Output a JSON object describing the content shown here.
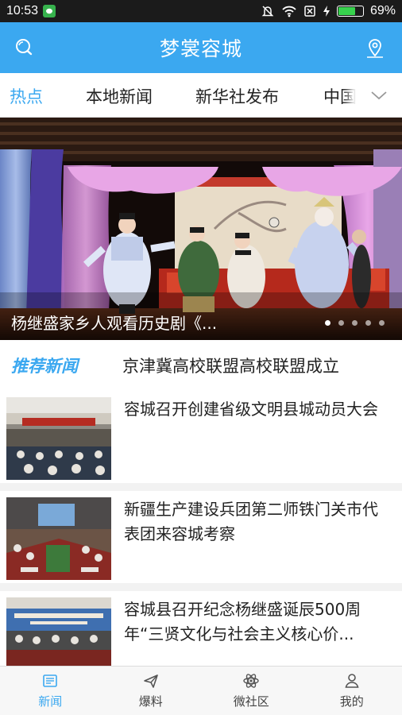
{
  "status": {
    "time": "10:53",
    "battery": "69%",
    "battery_level": 0.69
  },
  "header": {
    "title": "梦裳容城"
  },
  "tabs": [
    {
      "label": "热点",
      "active": true
    },
    {
      "label": "本地新闻",
      "active": false
    },
    {
      "label": "新华社发布",
      "active": false
    },
    {
      "label": "中国",
      "active": false
    }
  ],
  "hero": {
    "caption": "杨继盛家乡人观看历史剧《...",
    "dots": 5,
    "active_dot": 0
  },
  "recommended": {
    "tag": "推荐新闻",
    "headline": "京津冀高校联盟高校联盟成立"
  },
  "news": [
    {
      "title": "容城召开创建省级文明县城动员大会"
    },
    {
      "title": "新疆生产建设兵团第二师铁门关市代表团来容城考察"
    },
    {
      "title": "容城县召开纪念杨继盛诞辰500周年“三贤文化与社会主义核心价..."
    }
  ],
  "bottom_nav": [
    {
      "label": "新闻",
      "icon": "newspaper-icon",
      "active": true
    },
    {
      "label": "爆料",
      "icon": "paper-plane-icon",
      "active": false
    },
    {
      "label": "微社区",
      "icon": "atom-icon",
      "active": false
    },
    {
      "label": "我的",
      "icon": "person-icon",
      "active": false
    }
  ],
  "colors": {
    "brand": "#3ba8f0",
    "status_bar": "#1b1b1b"
  }
}
